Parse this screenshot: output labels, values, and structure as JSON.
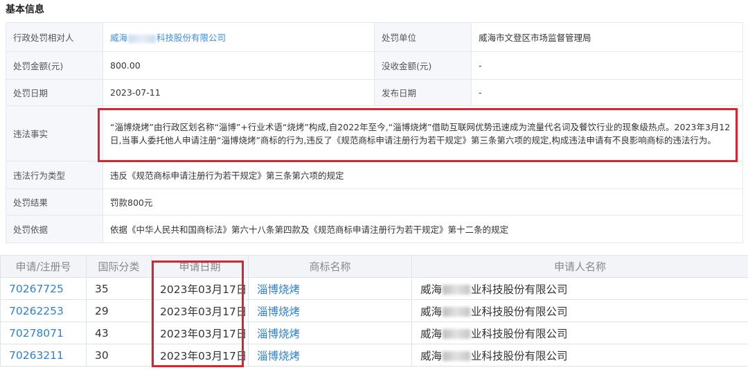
{
  "section_title": "基本信息",
  "info": {
    "target_label": "行政处罚相对人",
    "target_prefix": "威海",
    "target_suffix": "科技股份有限公司",
    "unit_label": "处罚单位",
    "unit_value": "威海市文登区市场监督管理局",
    "amount_label": "处罚金额(元)",
    "amount_value": "800.00",
    "confiscate_label": "没收金额(元)",
    "confiscate_value": "-",
    "date_label": "处罚日期",
    "date_value": "2023-07-11",
    "publish_label": "发布日期",
    "publish_value": "-",
    "fact_label": "违法事实",
    "fact_value": "“淄博烧烤”由行政区划名称“淄博”+行业术语“烧烤”构成,自2022年至今,“淄博烧烤”借助互联网优势迅速成为流量代名词及餐饮行业的现象级热点。2023年3月12日,当事人委托他人申请注册“淄博烧烤”商标的行为,违反了《规范商标申请注册行为若干规定》第三条第六项的规定,构成违法申请有不良影响商标的违法行为。",
    "type_label": "违法行为类型",
    "type_value": "违反《规范商标申请注册行为若干规定》第三条第六项的规定",
    "result_label": "处罚结果",
    "result_value": "罚款800元",
    "basis_label": "处罚依据",
    "basis_value": "依据《中华人民共和国商标法》第六十八条第四款及《规范商标申请注册行为若干规定》第十二条的规定"
  },
  "trademarks": {
    "headers": [
      "申请/注册号",
      "国际分类",
      "申请日期",
      "商标名称",
      "申请人名称"
    ],
    "rows": [
      {
        "no": "70267725",
        "cls": "35",
        "date": "2023年03月17日",
        "name": "淄博烧烤",
        "applicant_prefix": "威海",
        "applicant_suffix": "业科技股份有限公司"
      },
      {
        "no": "70262253",
        "cls": "29",
        "date": "2023年03月17日",
        "name": "淄博烧烤",
        "applicant_prefix": "威海",
        "applicant_suffix": "业科技股份有限公司"
      },
      {
        "no": "70278071",
        "cls": "43",
        "date": "2023年03月17日",
        "name": "淄博烧烤",
        "applicant_prefix": "威海",
        "applicant_suffix": "业科技股份有限公司"
      },
      {
        "no": "70263211",
        "cls": "30",
        "date": "2023年03月17日",
        "name": "淄博烧烤",
        "applicant_prefix": "威海",
        "applicant_suffix": "业科技股份有限公司"
      }
    ]
  },
  "colors": {
    "highlight": "#d9242f",
    "link": "#3a8ee6"
  }
}
